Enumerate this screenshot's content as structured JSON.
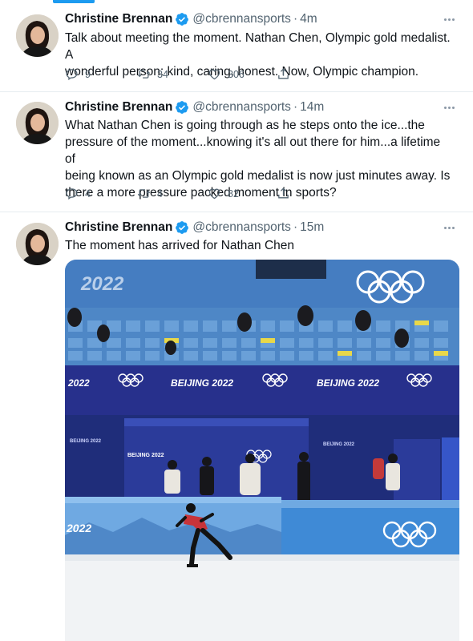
{
  "tweets": [
    {
      "name": "Christine Brennan",
      "handle": "@cbrennansports",
      "time": "4m",
      "text": "Talk about meeting the moment. Nathan Chen, Olympic gold medalist. A\nwonderful person: kind, caring, honest. Now, Olympic champion.",
      "replies": "9",
      "retweets": "34",
      "likes": "306"
    },
    {
      "name": "Christine Brennan",
      "handle": "@cbrennansports",
      "time": "14m",
      "text": "What Nathan Chen is going through as he steps onto the ice...the\npressure of the moment...knowing it's all out there for him...a lifetime of\nbeing known as an Olympic gold medalist is now just minutes away. Is\nthere a more pressure packed moment in sports?",
      "replies": "4",
      "retweets": "4",
      "likes": "82"
    },
    {
      "name": "Christine Brennan",
      "handle": "@cbrennansports",
      "time": "15m",
      "text": "The moment has arrived for Nathan Chen"
    }
  ],
  "photo": {
    "banner_top": "2022",
    "board_labels": [
      "2022",
      "BEIJING 2022",
      "BEIJING 2022"
    ],
    "booth_labels": [
      "BEIJING 2022",
      "BEIJING 2022",
      "BEIJING 2022"
    ],
    "rink_label": "2022"
  },
  "meta_separator": "·",
  "icons": [
    "verified-badge-icon",
    "more-icon",
    "reply-icon",
    "retweet-icon",
    "like-icon",
    "share-icon"
  ],
  "colors": {
    "accent": "#1d9bf0",
    "text": "#0f1419",
    "secondary": "#536471",
    "divider": "#e6ecf0"
  }
}
